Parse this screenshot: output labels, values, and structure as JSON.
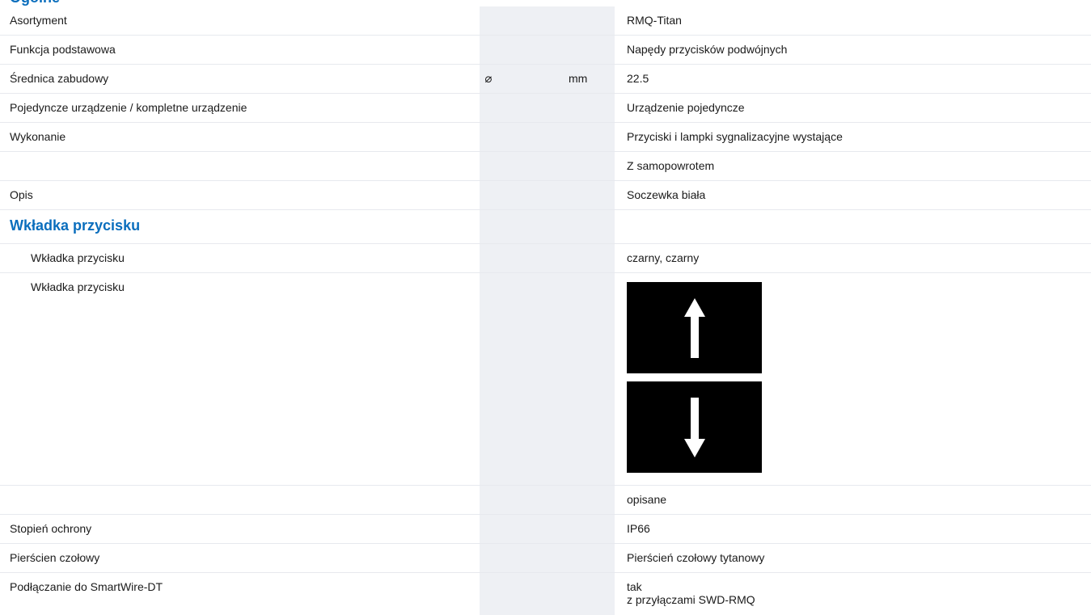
{
  "top_heading_cut": "Ogólne",
  "rows": {
    "asortyment": {
      "label": "Asortyment",
      "value": "RMQ-Titan"
    },
    "funkcja": {
      "label": "Funkcja podstawowa",
      "value": "Napędy przycisków podwójnych"
    },
    "srednica": {
      "label": "Średnica zabudowy",
      "symbol": "⌀",
      "unit": "mm",
      "value": "22.5"
    },
    "urzadzenie": {
      "label": "Pojedyncze urządzenie / kompletne urządzenie",
      "value": "Urządzenie pojedyncze"
    },
    "wykonanie": {
      "label": "Wykonanie",
      "value": "Przyciski i lampki sygnalizacyjne wystające"
    },
    "wykonanie2": {
      "label": "",
      "value": "Z samopowrotem"
    },
    "opis": {
      "label": "Opis",
      "value": "Soczewka biała"
    },
    "section_wkladka": {
      "label": "Wkładka przycisku"
    },
    "wkladka1": {
      "label": "Wkładka przycisku",
      "value": "czarny, czarny"
    },
    "wkladka2": {
      "label": "Wkładka przycisku",
      "icons": [
        "arrow-up-icon",
        "arrow-down-icon"
      ]
    },
    "opisane": {
      "label": "",
      "value": "opisane"
    },
    "stopien": {
      "label": "Stopień ochrony",
      "value": "IP66"
    },
    "pierscien": {
      "label": "Pierścien czołowy",
      "value": "Pierścień czołowy tytanowy"
    },
    "smartwire": {
      "label": "Podłączanie do SmartWire-DT",
      "value_line1": "tak",
      "value_line2": "z przyłączami SWD-RMQ"
    }
  },
  "colors": {
    "accent": "#0a6ebd",
    "column_shade": "#eef0f4",
    "divider": "#e7e9ee",
    "tile": "#000000"
  }
}
